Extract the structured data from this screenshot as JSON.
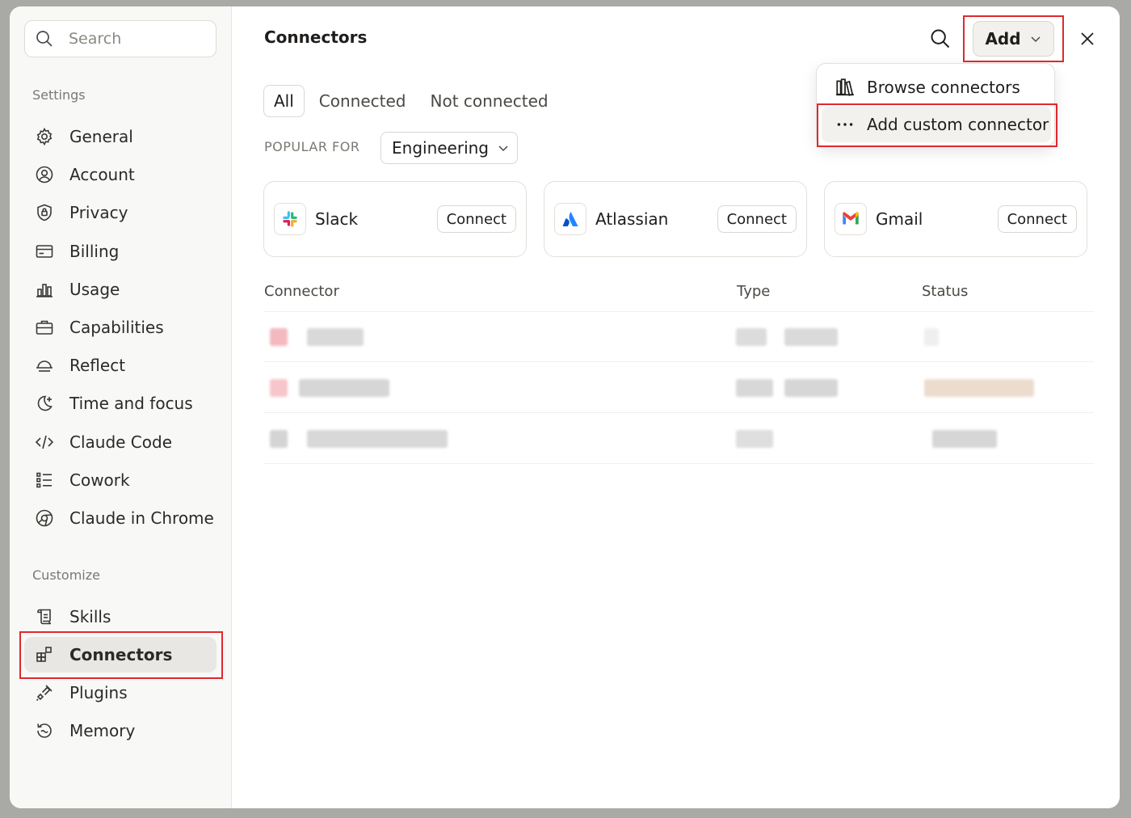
{
  "sidebar": {
    "search_placeholder": "Search",
    "settings_label": "Settings",
    "customize_label": "Customize",
    "settings_items": [
      {
        "label": "General",
        "icon": "gear-icon"
      },
      {
        "label": "Account",
        "icon": "user-circle-icon"
      },
      {
        "label": "Privacy",
        "icon": "shield-icon"
      },
      {
        "label": "Billing",
        "icon": "credit-card-icon"
      },
      {
        "label": "Usage",
        "icon": "bar-chart-icon"
      },
      {
        "label": "Capabilities",
        "icon": "briefcase-icon"
      },
      {
        "label": "Reflect",
        "icon": "sunrise-icon"
      },
      {
        "label": "Time and focus",
        "icon": "moon-plus-icon"
      },
      {
        "label": "Claude Code",
        "icon": "code-icon"
      },
      {
        "label": "Cowork",
        "icon": "list-icon"
      },
      {
        "label": "Claude in Chrome",
        "icon": "globe-icon"
      }
    ],
    "customize_items": [
      {
        "label": "Skills",
        "icon": "scroll-icon"
      },
      {
        "label": "Connectors",
        "icon": "grid-plus-icon",
        "active": true
      },
      {
        "label": "Plugins",
        "icon": "plug-icon"
      },
      {
        "label": "Memory",
        "icon": "history-icon"
      }
    ]
  },
  "header": {
    "title": "Connectors",
    "add_label": "Add"
  },
  "tabs": [
    "All",
    "Connected",
    "Not connected"
  ],
  "popular": {
    "label": "POPULAR FOR",
    "selected": "Engineering"
  },
  "cards": [
    {
      "name": "Slack",
      "action": "Connect",
      "icon": "slack-icon"
    },
    {
      "name": "Atlassian",
      "action": "Connect",
      "icon": "atlassian-icon"
    },
    {
      "name": "Gmail",
      "action": "Connect",
      "icon": "gmail-icon"
    }
  ],
  "table": {
    "columns": [
      "Connector",
      "Type",
      "Status"
    ]
  },
  "dropdown": {
    "items": [
      {
        "label": "Browse connectors",
        "icon": "library-icon"
      },
      {
        "label": "Add custom connector",
        "icon": "more-horizontal-icon"
      }
    ]
  },
  "colors": {
    "highlight": "#e0292e",
    "active_nav_bg": "#e8e7e3"
  }
}
